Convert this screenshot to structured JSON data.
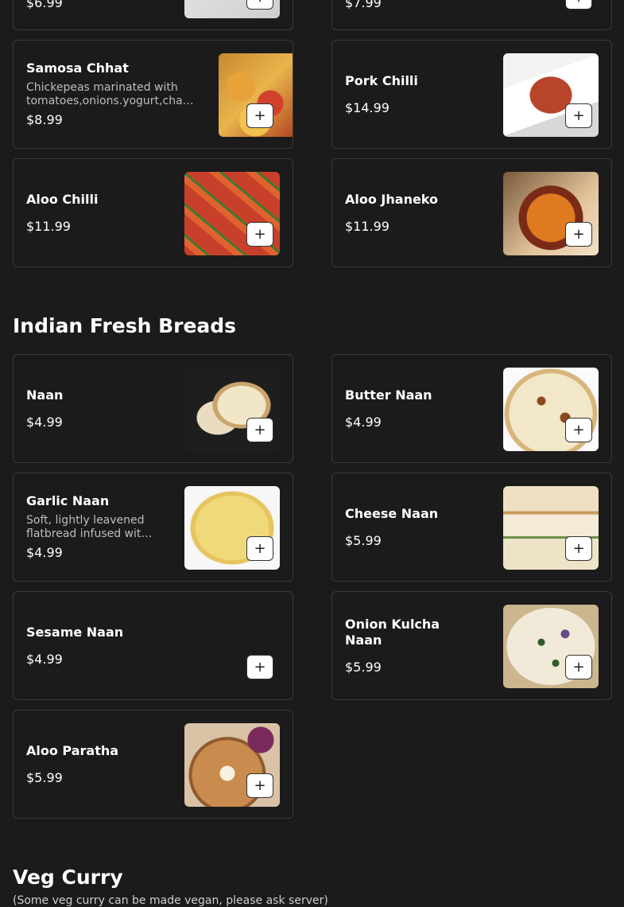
{
  "partial_top": {
    "left": {
      "price": "$6.99",
      "add_label": "+"
    },
    "right": {
      "price": "$7.99",
      "add_label": "+"
    }
  },
  "items_top": [
    {
      "name": "Samosa Chhat",
      "description": "Chickepeas marinated with tomatoes,onions.yogurt,chat masala,sev",
      "price": "$8.99",
      "image": "samosa-chhat",
      "add_label": "+"
    },
    {
      "name": "Pork Chilli",
      "description": "",
      "price": "$14.99",
      "image": "pork-chilli",
      "add_label": "+"
    },
    {
      "name": "Aloo Chilli",
      "description": "",
      "price": "$11.99",
      "image": "aloo-chilli",
      "add_label": "+"
    },
    {
      "name": "Aloo Jhaneko",
      "description": "",
      "price": "$11.99",
      "image": "aloo-jhaneko",
      "add_label": "+"
    }
  ],
  "breads": {
    "title": "Indian Fresh Breads",
    "items": [
      {
        "name": "Naan",
        "description": "",
        "price": "$4.99",
        "image": "naan",
        "add_label": "+"
      },
      {
        "name": "Butter Naan",
        "description": "",
        "price": "$4.99",
        "image": "butter-naan",
        "add_label": "+"
      },
      {
        "name": "Garlic Naan",
        "description": "Soft, lightly leavened flatbread infused with garlic and herbs",
        "price": "$4.99",
        "image": "garlic-naan",
        "add_label": "+"
      },
      {
        "name": "Cheese Naan",
        "description": "",
        "price": "$5.99",
        "image": "cheese-naan",
        "add_label": "+"
      },
      {
        "name": "Sesame Naan",
        "description": "",
        "price": "$4.99",
        "image": "",
        "add_label": "+"
      },
      {
        "name": "Onion Kulcha Naan",
        "description": "",
        "price": "$5.99",
        "image": "onion-kulcha-naan",
        "add_label": "+"
      },
      {
        "name": "Aloo Paratha",
        "description": "",
        "price": "$5.99",
        "image": "aloo-paratha",
        "add_label": "+"
      }
    ]
  },
  "veg_curry": {
    "title": "Veg Curry",
    "subtitle": "(Some veg curry can be made vegan, please ask server)"
  }
}
